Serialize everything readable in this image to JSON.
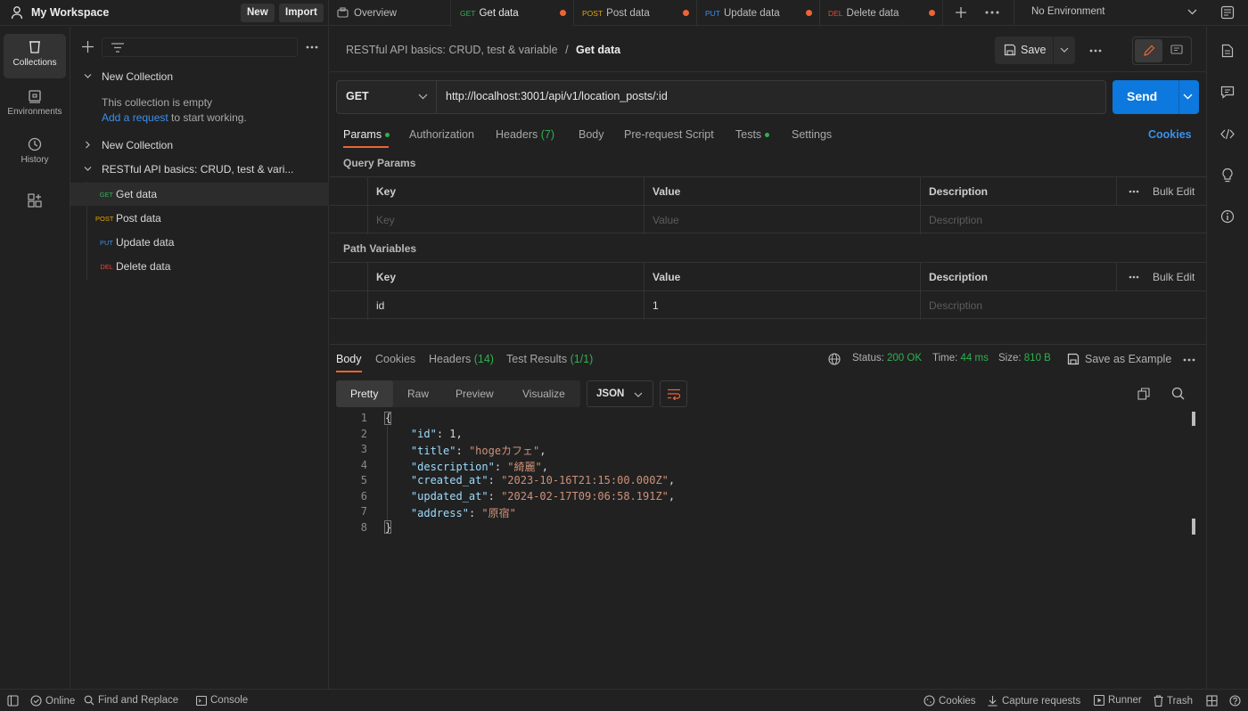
{
  "workspace": {
    "title": "My Workspace",
    "new_label": "New",
    "import_label": "Import"
  },
  "tabs": [
    {
      "method": "",
      "label": "Overview"
    },
    {
      "method": "GET",
      "label": "Get data"
    },
    {
      "method": "POST",
      "label": "Post data"
    },
    {
      "method": "PUT",
      "label": "Update data"
    },
    {
      "method": "DEL",
      "label": "Delete data"
    }
  ],
  "environment": "No Environment",
  "rail": [
    {
      "label": "Collections",
      "icon": "collections-icon"
    },
    {
      "label": "Environments",
      "icon": "environments-icon"
    },
    {
      "label": "History",
      "icon": "history-icon"
    }
  ],
  "tree": {
    "collection1": "New Collection",
    "empty_line1": "This collection is empty",
    "empty_link": "Add a request",
    "empty_line2": " to start working.",
    "collection2": "New Collection",
    "collection3": "RESTful API basics: CRUD, test & vari...",
    "requests": [
      {
        "method": "GET",
        "label": "Get data"
      },
      {
        "method": "POST",
        "label": "Post data"
      },
      {
        "method": "PUT",
        "label": "Update data"
      },
      {
        "method": "DEL",
        "label": "Delete data"
      }
    ]
  },
  "request": {
    "breadcrumb_parent": "RESTful API basics: CRUD, test & variable",
    "breadcrumb_sep": "/",
    "breadcrumb_current": "Get data",
    "save_label": "Save",
    "method": "GET",
    "url": "http://localhost:3001/api/v1/location_posts/:id",
    "send_label": "Send",
    "tabs": [
      "Params",
      "Authorization",
      "Headers",
      "Body",
      "Pre-request Script",
      "Tests",
      "Settings"
    ],
    "headers_count": "(7)",
    "cookies_label": "Cookies",
    "query_params_title": "Query Params",
    "path_vars_title": "Path Variables",
    "col_key": "Key",
    "col_value": "Value",
    "col_desc": "Description",
    "bulk_edit": "Bulk Edit",
    "query_placeholder": {
      "key": "Key",
      "value": "Value",
      "desc": "Description"
    },
    "path_row": {
      "key": "id",
      "value": "1",
      "desc": "Description"
    }
  },
  "response": {
    "tabs": [
      "Body",
      "Cookies",
      "Headers",
      "Test Results"
    ],
    "headers_count": "(14)",
    "test_count": "(1/1)",
    "status_label": "Status:",
    "status_value": "200 OK",
    "time_label": "Time:",
    "time_value": "44 ms",
    "size_label": "Size:",
    "size_value": "810 B",
    "save_example": "Save as Example",
    "formats": [
      "Pretty",
      "Raw",
      "Preview",
      "Visualize"
    ],
    "format_type": "JSON",
    "lines": [
      "1",
      "2",
      "3",
      "4",
      "5",
      "6",
      "7",
      "8"
    ],
    "json": {
      "open": "{",
      "id_key": "\"id\"",
      "id_val": "1",
      "title_key": "\"title\"",
      "title_val": "\"hogeカフェ\"",
      "desc_key": "\"description\"",
      "desc_val": "\"綺麗\"",
      "created_key": "\"created_at\"",
      "created_val": "\"2023-10-16T21:15:00.000Z\"",
      "updated_key": "\"updated_at\"",
      "updated_val": "\"2024-02-17T09:06:58.191Z\"",
      "address_key": "\"address\"",
      "address_val": "\"原宿\"",
      "close": "}"
    }
  },
  "status_bar": {
    "online": "Online",
    "find_replace": "Find and Replace",
    "console": "Console",
    "cookies": "Cookies",
    "capture": "Capture requests",
    "runner": "Runner",
    "trash": "Trash"
  },
  "colors": {
    "get": "#2fb14f",
    "post": "#e6a300",
    "put": "#3c8fe8",
    "del": "#e04a3a",
    "accent": "#0d78dd",
    "tab_dot": "#ef6337"
  }
}
